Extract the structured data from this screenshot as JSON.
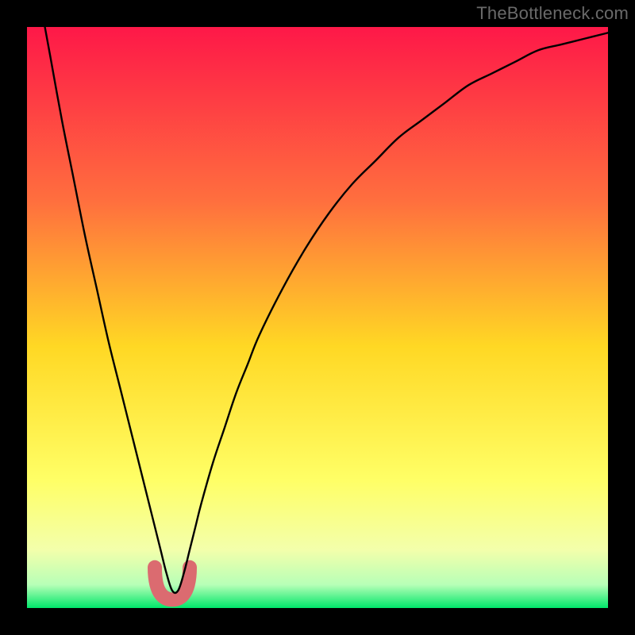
{
  "watermark": "TheBottleneck.com",
  "colors": {
    "frame": "#000000",
    "watermark": "#6a6a6a",
    "curve": "#000000",
    "optimal_marker": "#db6b70",
    "gradient_top": "#fe1848",
    "gradient_mid1": "#ff6f3e",
    "gradient_mid2": "#ffd824",
    "gradient_mid3": "#ffff66",
    "gradient_mid4": "#f3ffab",
    "gradient_mid5": "#b7ffb7",
    "gradient_bottom": "#00e66a"
  },
  "chart_data": {
    "type": "line",
    "title": "",
    "xlabel": "",
    "ylabel": "",
    "xlim": [
      0,
      100
    ],
    "ylim": [
      0,
      100
    ],
    "optimal_x": 25,
    "series": [
      {
        "name": "bottleneck-curve",
        "x": [
          0,
          2,
          4,
          6,
          8,
          10,
          12,
          14,
          16,
          18,
          20,
          21,
          22,
          23,
          24,
          25,
          26,
          27,
          28,
          29,
          30,
          32,
          34,
          36,
          38,
          40,
          44,
          48,
          52,
          56,
          60,
          64,
          68,
          72,
          76,
          80,
          84,
          88,
          92,
          96,
          100
        ],
        "y": [
          118,
          106,
          95,
          84,
          74,
          64,
          55,
          46,
          38,
          30,
          22,
          18,
          14,
          10,
          6,
          3,
          3,
          6,
          10,
          14,
          18,
          25,
          31,
          37,
          42,
          47,
          55,
          62,
          68,
          73,
          77,
          81,
          84,
          87,
          90,
          92,
          94,
          96,
          97,
          98,
          99
        ]
      }
    ],
    "annotations": [
      {
        "name": "optimal-zone",
        "x_range": [
          22,
          28
        ],
        "y_range": [
          2,
          7
        ]
      }
    ]
  }
}
